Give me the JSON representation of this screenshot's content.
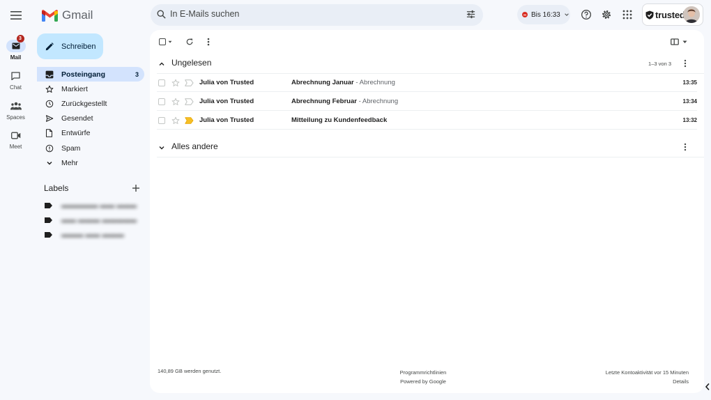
{
  "header": {
    "logo_text": "Gmail",
    "search_placeholder": "In E-Mails suchen",
    "status_label": "Bis 16:33",
    "account_brand": "trusted"
  },
  "rail": [
    {
      "label": "Mail",
      "badge": "3",
      "icon": "mail-icon"
    },
    {
      "label": "Chat",
      "icon": "chat-icon"
    },
    {
      "label": "Spaces",
      "icon": "spaces-icon"
    },
    {
      "label": "Meet",
      "icon": "meet-icon"
    }
  ],
  "compose": {
    "label": "Schreiben"
  },
  "nav": [
    {
      "label": "Posteingang",
      "count": "3",
      "icon": "inbox-icon"
    },
    {
      "label": "Markiert",
      "icon": "star-icon"
    },
    {
      "label": "Zurückgestellt",
      "icon": "clock-icon"
    },
    {
      "label": "Gesendet",
      "icon": "send-icon"
    },
    {
      "label": "Entwürfe",
      "icon": "draft-icon"
    },
    {
      "label": "Spam",
      "icon": "spam-icon"
    },
    {
      "label": "Mehr",
      "icon": "chevron-down-icon"
    }
  ],
  "labels": {
    "title": "Labels"
  },
  "sections": {
    "unread": {
      "title": "Ungelesen",
      "count": "1–3 von 3"
    },
    "other": {
      "title": "Alles andere"
    }
  },
  "emails": [
    {
      "sender": "Julia von Trusted",
      "subject": "Abrechnung Januar",
      "snippet": "- Abrechnung",
      "time": "13:35",
      "important": false
    },
    {
      "sender": "Julia von Trusted",
      "subject": "Abrechnung Februar",
      "snippet": "- Abrechnung",
      "time": "13:34",
      "important": false
    },
    {
      "sender": "Julia von Trusted",
      "subject": "Mitteilung zu Kundenfeedback",
      "snippet": "",
      "time": "13:32",
      "important": true
    }
  ],
  "footer": {
    "storage": "140,89 GB werden genutzt.",
    "policies": "Programmrichtlinien",
    "powered": "Powered by Google",
    "activity": "Letzte Kontoaktivität vor 15 Minuten",
    "details": "Details"
  },
  "colors": {
    "background": "#f6f8fc",
    "compose": "#c2e7ff",
    "active_nav": "#d3e3fd",
    "badge": "#b3261e",
    "important": "#f6bf26"
  }
}
